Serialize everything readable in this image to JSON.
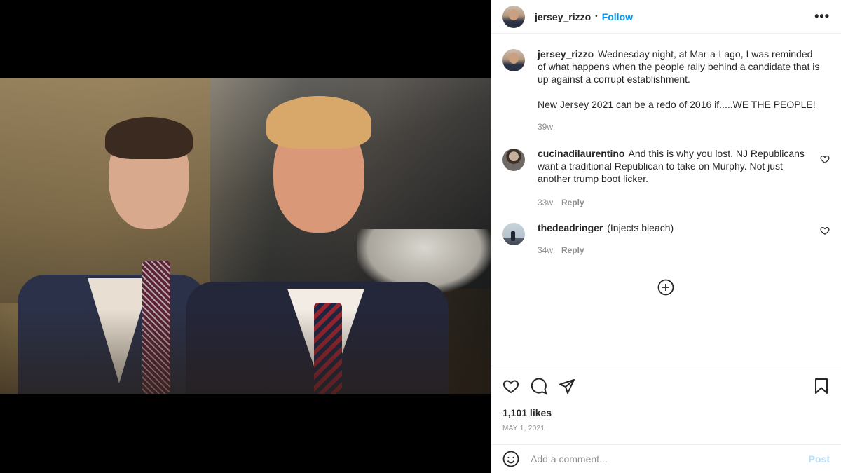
{
  "post": {
    "author": "jersey_rizzo",
    "header": {
      "separator": "•",
      "follow_label": "Follow",
      "more_icon": "more-horizontal-icon"
    },
    "caption": {
      "username": "jersey_rizzo",
      "text_1": "Wednesday night, at Mar-a-Lago, I was reminded of what happens when the people rally behind a candidate that is up against a corrupt establishment.",
      "text_2": "New Jersey 2021 can be a redo of 2016 if.....WE THE PEOPLE!",
      "age": "39w"
    },
    "comments": [
      {
        "username": "cucinadilaurentino",
        "text": "And this is why you lost. NJ Republicans want a traditional Republican to take on Murphy. Not just another trump boot licker.",
        "age": "33w",
        "reply_label": "Reply"
      },
      {
        "username": "thedeadringer",
        "text": "(Injects bleach)",
        "age": "34w",
        "reply_label": "Reply"
      }
    ],
    "likes": "1,101 likes",
    "date": "MAY 1, 2021",
    "add_comment": {
      "placeholder": "Add a comment...",
      "post_label": "Post"
    },
    "colors": {
      "link_blue": "#0095f6",
      "post_disabled": "#b2dffc",
      "muted": "#8e8e8e",
      "text": "#262626"
    }
  }
}
